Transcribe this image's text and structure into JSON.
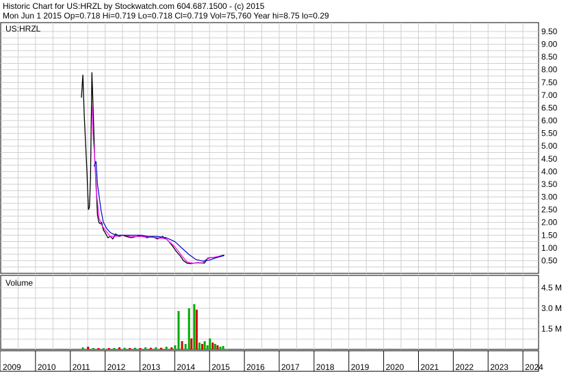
{
  "header": {
    "line1": "Historic Chart for US:HRZL by Stockwatch.com 604.687.1500 - (c) 2015",
    "line2": "Mon Jun  1 2015  Op=0.718  Hi=0.719  Lo=0.718  Cl=0.719  Vol=75,760  Year hi=8.75  lo=0.29"
  },
  "symbol_label": "US:HRZL",
  "volume_label": "Volume",
  "colors": {
    "price": "#000000",
    "ma_short": "#ff00ff",
    "ma_long": "#0000cc",
    "vol_up": "#00aa00",
    "vol_down": "#cc0000",
    "grid": "#cfcfcf",
    "frame": "#000000"
  },
  "chart_data": [
    {
      "type": "line",
      "title": "Historic Chart for US:HRZL",
      "yunit": "USD",
      "y_ticks": [
        "0.50",
        "1.00",
        "1.50",
        "2.00",
        "2.50",
        "3.00",
        "3.50",
        "4.00",
        "4.50",
        "5.00",
        "5.50",
        "6.00",
        "6.50",
        "7.00",
        "7.50",
        "8.00",
        "8.50",
        "9.00",
        "9.50"
      ],
      "ylim": [
        0.0,
        9.85
      ],
      "x_ticks": [
        "2009",
        "2010",
        "2011",
        "2012",
        "2013",
        "2014",
        "2015",
        "2016",
        "2017",
        "2018",
        "2019",
        "2020",
        "2021",
        "2022",
        "2023",
        "2024"
      ],
      "xlim": [
        2009.0,
        2024.45
      ],
      "grid": true,
      "series": [
        {
          "style": "price",
          "x": [
            2011.32,
            2011.36,
            2011.4,
            2011.44,
            2011.48,
            2011.52,
            2011.55,
            2011.58,
            2011.62,
            2011.66,
            2011.7,
            2011.74,
            2011.78,
            2011.82,
            2011.86,
            2011.9,
            2011.95,
            2012.0,
            2012.08,
            2012.15,
            2012.22,
            2012.3,
            2012.4,
            2012.5,
            2012.6,
            2012.75,
            2012.9,
            2013.05,
            2013.2,
            2013.35,
            2013.5,
            2013.65,
            2013.8,
            2013.95,
            2014.05,
            2014.15,
            2014.25,
            2014.35,
            2014.45,
            2014.55,
            2014.65,
            2014.75,
            2014.85,
            2014.95,
            2015.05,
            2015.15,
            2015.25,
            2015.33,
            2015.42
          ],
          "y": [
            6.9,
            7.8,
            6.2,
            5.1,
            3.9,
            2.5,
            2.6,
            3.8,
            7.9,
            6.3,
            4.5,
            3.5,
            2.3,
            2.0,
            1.95,
            2.0,
            1.7,
            1.6,
            1.4,
            1.45,
            1.35,
            1.55,
            1.45,
            1.5,
            1.45,
            1.4,
            1.45,
            1.5,
            1.4,
            1.45,
            1.35,
            1.45,
            1.3,
            1.05,
            0.85,
            0.7,
            0.5,
            0.4,
            0.38,
            0.4,
            0.42,
            0.41,
            0.4,
            0.6,
            0.62,
            0.63,
            0.66,
            0.69,
            0.72
          ]
        },
        {
          "style": "ma_short",
          "x": [
            2011.62,
            2011.66,
            2011.7,
            2011.74,
            2011.78,
            2011.82,
            2011.9,
            2012.0,
            2012.15,
            2012.3,
            2012.5,
            2012.75,
            2013.0,
            2013.25,
            2013.5,
            2013.75,
            2014.0,
            2014.2,
            2014.35,
            2014.5,
            2014.65,
            2014.8,
            2014.9,
            2015.0,
            2015.2,
            2015.42
          ],
          "y": [
            6.6,
            5.3,
            4.6,
            3.3,
            2.8,
            2.2,
            1.9,
            1.7,
            1.45,
            1.45,
            1.5,
            1.45,
            1.45,
            1.42,
            1.4,
            1.35,
            1.05,
            0.7,
            0.45,
            0.4,
            0.41,
            0.4,
            0.55,
            0.6,
            0.65,
            0.7
          ]
        },
        {
          "style": "ma_long",
          "x": [
            2011.68,
            2011.74,
            2011.78,
            2011.82,
            2011.88,
            2011.95,
            2012.05,
            2012.15,
            2012.3,
            2012.5,
            2012.75,
            2013.0,
            2013.25,
            2013.5,
            2013.75,
            2014.0,
            2014.2,
            2014.4,
            2014.6,
            2014.8,
            2015.0,
            2015.2,
            2015.42
          ],
          "y": [
            4.2,
            4.4,
            3.5,
            3.1,
            2.5,
            2.0,
            1.75,
            1.6,
            1.5,
            1.5,
            1.5,
            1.5,
            1.45,
            1.45,
            1.4,
            1.25,
            1.0,
            0.75,
            0.55,
            0.48,
            0.52,
            0.62,
            0.7
          ]
        }
      ]
    },
    {
      "type": "bar",
      "title": "Volume",
      "y_ticks": [
        "1.5 M",
        "3.0 M",
        "4.5 M"
      ],
      "ylim": [
        0.0,
        5.4
      ],
      "grid": true,
      "series": [
        {
          "name": "Volume",
          "x": [
            2011.35,
            2011.5,
            2011.65,
            2011.8,
            2011.95,
            2012.1,
            2012.25,
            2012.4,
            2012.55,
            2012.7,
            2012.85,
            2013.0,
            2013.15,
            2013.3,
            2013.45,
            2013.6,
            2013.75,
            2013.9,
            2014.0,
            2014.1,
            2014.2,
            2014.3,
            2014.4,
            2014.47,
            2014.55,
            2014.62,
            2014.7,
            2014.78,
            2014.85,
            2014.93,
            2015.0,
            2015.08,
            2015.15,
            2015.22,
            2015.3,
            2015.38
          ],
          "y": [
            0.15,
            0.2,
            0.1,
            0.1,
            0.08,
            0.1,
            0.1,
            0.15,
            0.12,
            0.1,
            0.12,
            0.1,
            0.15,
            0.12,
            0.15,
            0.12,
            0.2,
            0.15,
            0.3,
            2.8,
            0.6,
            0.4,
            3.0,
            0.8,
            3.3,
            2.9,
            0.5,
            0.4,
            0.6,
            0.3,
            0.8,
            0.5,
            0.4,
            0.3,
            0.2,
            0.25
          ],
          "direction": [
            "up",
            "down",
            "up",
            "down",
            "up",
            "down",
            "up",
            "down",
            "up",
            "down",
            "up",
            "down",
            "up",
            "down",
            "up",
            "down",
            "up",
            "down",
            "up",
            "up",
            "down",
            "up",
            "up",
            "down",
            "up",
            "down",
            "up",
            "down",
            "up",
            "up",
            "up",
            "down",
            "up",
            "down",
            "up",
            "up"
          ]
        }
      ]
    }
  ]
}
